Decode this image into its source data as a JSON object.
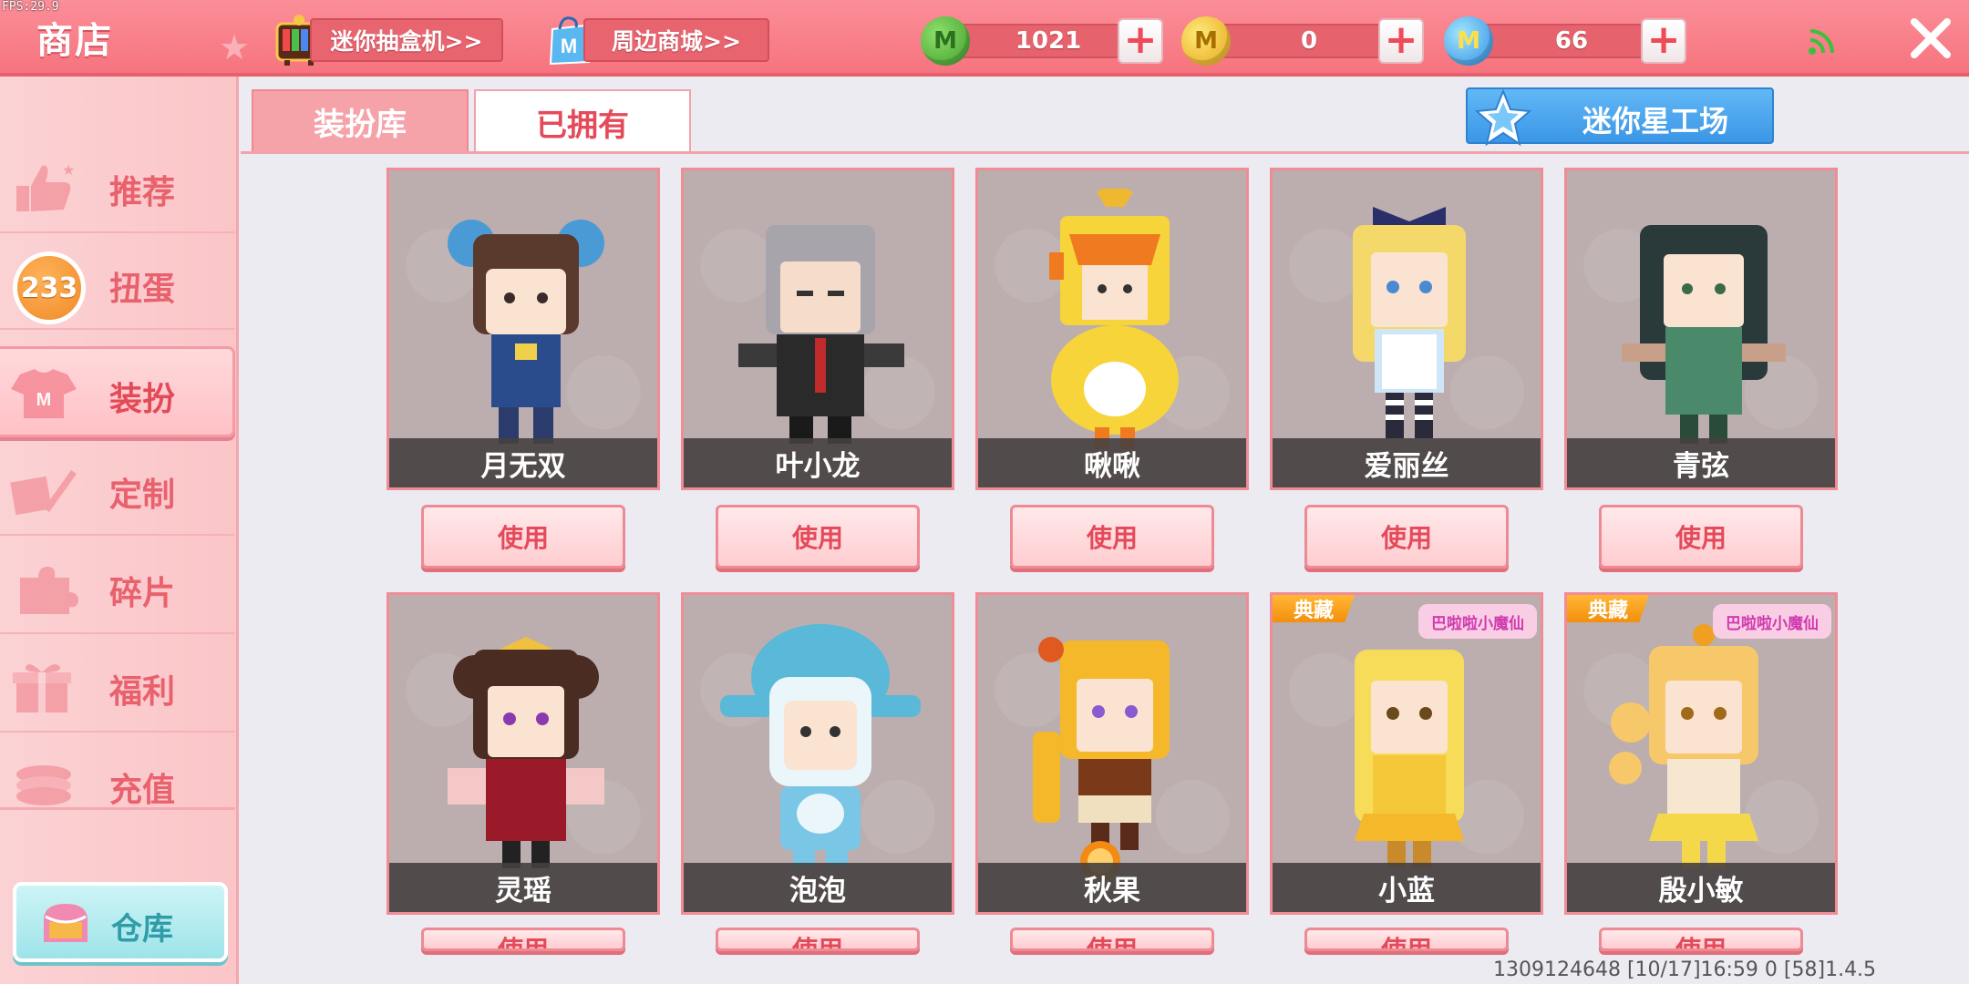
{
  "fps": "FPS:29.9",
  "header": {
    "title": "商店",
    "link_gacha": "迷你抽盒机>>",
    "link_mall": "周边商城>>",
    "currencies": [
      {
        "icon": "green-bean-coin-icon",
        "value": "1021",
        "color": "#4aa83a"
      },
      {
        "icon": "gold-coin-icon",
        "value": "0",
        "color": "#eeb31e"
      },
      {
        "icon": "blue-coin-icon",
        "value": "66",
        "color": "#3a96e6"
      }
    ],
    "coin_glyph": "M"
  },
  "sidebar": {
    "items": [
      {
        "label": "推荐",
        "icon": "thumbs-up-icon"
      },
      {
        "label": "扭蛋",
        "icon": "capsule-icon",
        "badge": "233"
      },
      {
        "label": "装扮",
        "icon": "tshirt-icon",
        "active": true
      },
      {
        "label": "定制",
        "icon": "pencil-icon"
      },
      {
        "label": "碎片",
        "icon": "puzzle-icon"
      },
      {
        "label": "福利",
        "icon": "gift-icon"
      },
      {
        "label": "充值",
        "icon": "coins-icon"
      }
    ],
    "warehouse": "仓库"
  },
  "tabs": {
    "wardrobe": "装扮库",
    "owned": "已拥有",
    "workshop": "迷你星工场"
  },
  "cards": [
    {
      "name": "月无双",
      "action": "使用"
    },
    {
      "name": "叶小龙",
      "action": "使用"
    },
    {
      "name": "啾啾",
      "action": "使用"
    },
    {
      "name": "爱丽丝",
      "action": "使用"
    },
    {
      "name": "青弦",
      "action": "使用"
    },
    {
      "name": "灵瑶",
      "action": "使用"
    },
    {
      "name": "泡泡",
      "action": "使用"
    },
    {
      "name": "秋果",
      "action": "使用"
    },
    {
      "name": "小蓝",
      "action": "使用",
      "badge": "典藏",
      "logo": "巴啦啦小魔仙"
    },
    {
      "name": "殷小敏",
      "action": "使用",
      "badge": "典藏",
      "logo": "巴啦啦小魔仙"
    }
  ],
  "footer": {
    "info": "1309124648   [10/17]16:59 0   [58]1.4.5"
  }
}
